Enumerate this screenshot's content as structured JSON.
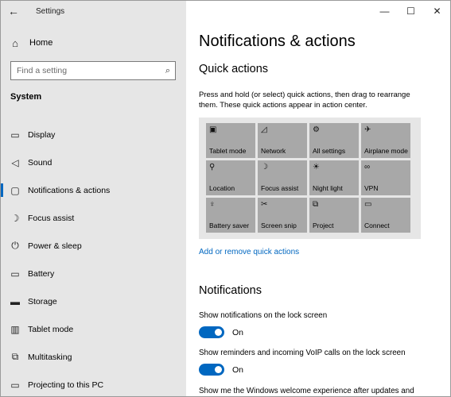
{
  "app": {
    "title": "Settings"
  },
  "titlebar": {
    "back_icon": "←",
    "min_icon": "—",
    "max_icon": "☐",
    "close_icon": "✕"
  },
  "sidebar": {
    "home": {
      "icon": "⌂",
      "label": "Home"
    },
    "search": {
      "placeholder": "Find a setting",
      "icon": "⌕"
    },
    "section_title": "System",
    "items": [
      {
        "icon": "▭",
        "label": "Display",
        "active": false
      },
      {
        "icon": "◁",
        "label": "Sound",
        "active": false
      },
      {
        "icon": "▢",
        "label": "Notifications & actions",
        "active": true
      },
      {
        "icon": "☽",
        "label": "Focus assist",
        "active": false
      },
      {
        "icon": "⏻",
        "label": "Power & sleep",
        "active": false
      },
      {
        "icon": "▭",
        "label": "Battery",
        "active": false
      },
      {
        "icon": "▬",
        "label": "Storage",
        "active": false
      },
      {
        "icon": "▥",
        "label": "Tablet mode",
        "active": false
      },
      {
        "icon": "⧉",
        "label": "Multitasking",
        "active": false
      },
      {
        "icon": "▭",
        "label": "Projecting to this PC",
        "active": false
      }
    ]
  },
  "main": {
    "title": "Notifications & actions",
    "quick_actions": {
      "heading": "Quick actions",
      "description": "Press and hold (or select) quick actions, then drag to rearrange them. These quick actions appear in action center.",
      "tiles": [
        {
          "icon": "▣",
          "label": "Tablet mode"
        },
        {
          "icon": "◿",
          "label": "Network"
        },
        {
          "icon": "⚙",
          "label": "All settings"
        },
        {
          "icon": "✈",
          "label": "Airplane mode"
        },
        {
          "icon": "⚲",
          "label": "Location"
        },
        {
          "icon": "☽",
          "label": "Focus assist"
        },
        {
          "icon": "☀",
          "label": "Night light"
        },
        {
          "icon": "∞",
          "label": "VPN"
        },
        {
          "icon": "♀",
          "label": "Battery saver"
        },
        {
          "icon": "✂",
          "label": "Screen snip"
        },
        {
          "icon": "⧉",
          "label": "Project"
        },
        {
          "icon": "▭",
          "label": "Connect"
        }
      ],
      "link": "Add or remove quick actions"
    },
    "notifications": {
      "heading": "Notifications",
      "settings": [
        {
          "label": "Show notifications on the lock screen",
          "state": "On"
        },
        {
          "label": "Show reminders and incoming VoIP calls on the lock screen",
          "state": "On"
        },
        {
          "label": "Show me the Windows welcome experience after updates and"
        }
      ]
    }
  },
  "colors": {
    "accent": "#0067c0",
    "sidebar_bg": "#e6e6e6",
    "tile_bg": "#a8a8a8"
  }
}
